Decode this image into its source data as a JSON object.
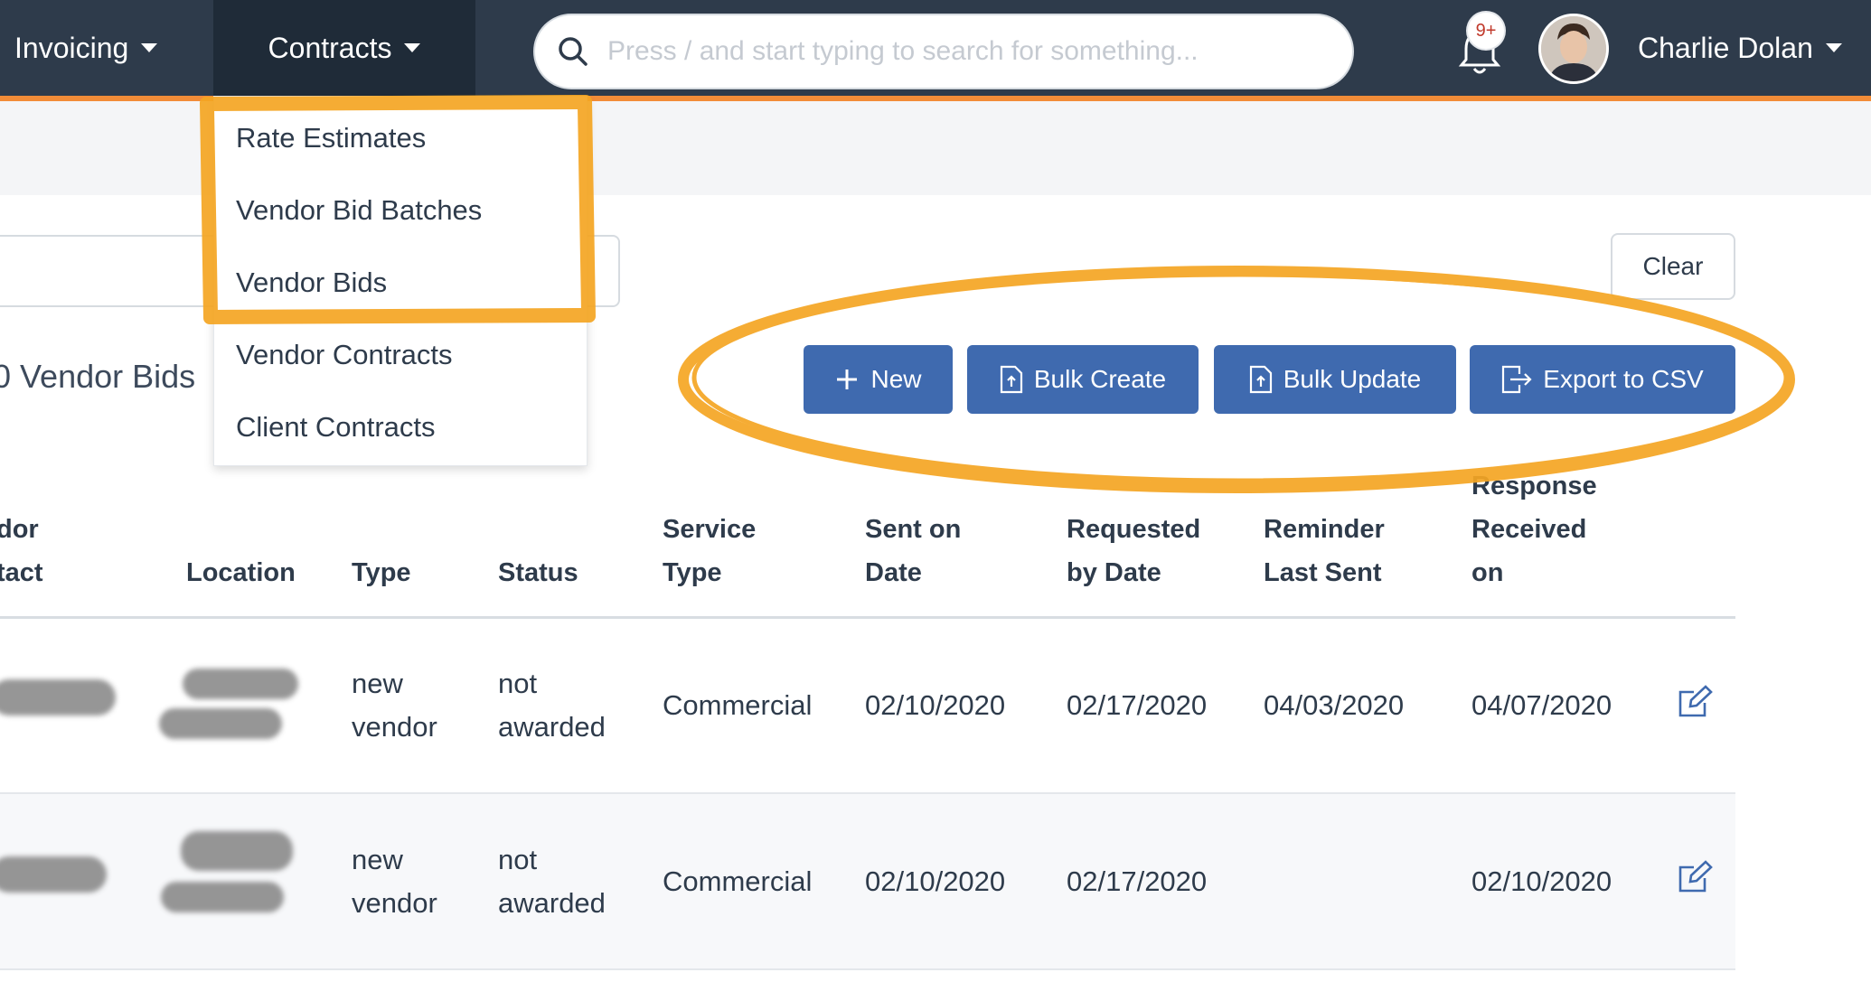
{
  "nav": {
    "invoicing_label": "Invoicing",
    "contracts_label": "Contracts",
    "search_placeholder": "Press / and start typing to search for something...",
    "notification_badge": "9+",
    "user_name": "Charlie Dolan"
  },
  "contracts_menu": {
    "items": [
      "Rate Estimates",
      "Vendor Bid Batches",
      "Vendor Bids",
      "Vendor Contracts",
      "Client Contracts"
    ]
  },
  "toolbar": {
    "clear_label": "Clear",
    "count_title": "0 Vendor Bids",
    "new_label": "New",
    "bulk_create_label": "Bulk Create",
    "bulk_update_label": "Bulk Update",
    "export_label": "Export to CSV"
  },
  "table": {
    "headers": {
      "vendor_contact": [
        "dor",
        "tact"
      ],
      "location": "Location",
      "type": "Type",
      "status": "Status",
      "service_type": [
        "Service",
        "Type"
      ],
      "sent_on": [
        "Sent on",
        "Date"
      ],
      "requested_by": [
        "Requested",
        "by Date"
      ],
      "reminder": [
        "Reminder",
        "Last Sent"
      ],
      "response": [
        "Response",
        "Received",
        "on"
      ]
    },
    "rows": [
      {
        "type": [
          "new",
          "vendor"
        ],
        "status": [
          "not",
          "awarded"
        ],
        "service_type": "Commercial",
        "sent_on": "02/10/2020",
        "requested_by": "02/17/2020",
        "reminder": "04/03/2020",
        "response": "04/07/2020"
      },
      {
        "type": [
          "new",
          "vendor"
        ],
        "status": [
          "not",
          "awarded"
        ],
        "service_type": "Commercial",
        "sent_on": "02/10/2020",
        "requested_by": "02/17/2020",
        "reminder": "",
        "response": "02/10/2020"
      }
    ]
  },
  "colors": {
    "topbar": "#2e3b4b",
    "accent": "#f28c38",
    "button": "#3f6aaf",
    "highlight": "#f5a623"
  }
}
